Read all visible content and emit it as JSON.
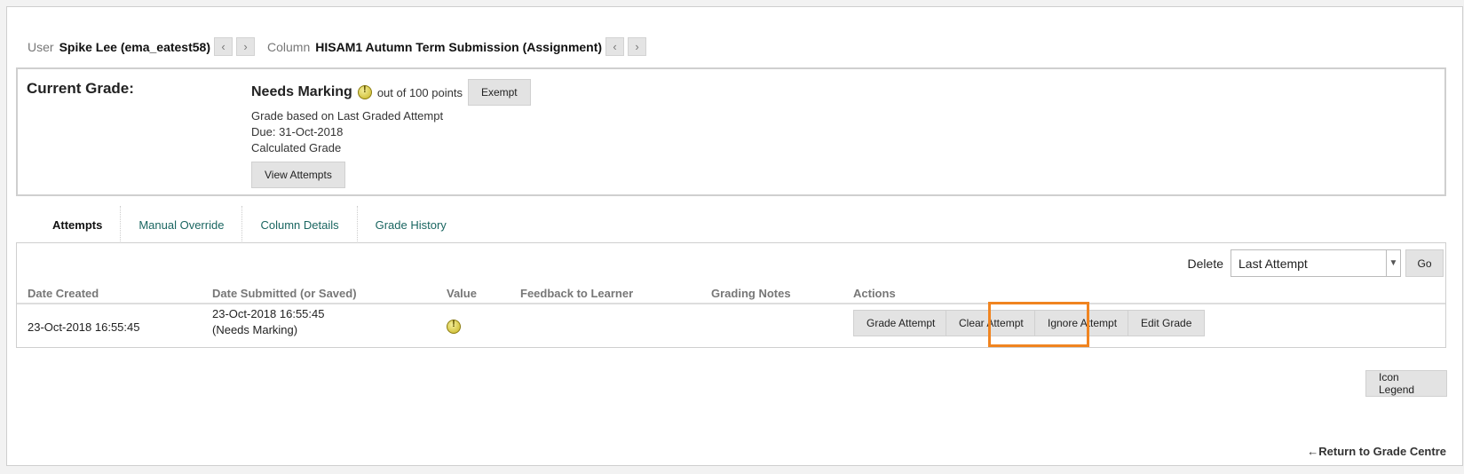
{
  "user_bar": {
    "user_label": "User",
    "user_name": "Spike Lee (ema_eatest58)",
    "column_label": "Column",
    "column_name": "HISAM1 Autumn Term Submission (Assignment)",
    "prev_glyph": "‹",
    "next_glyph": "›"
  },
  "current_grade": {
    "title": "Current Grade:",
    "status": "Needs Marking",
    "out_of": "out of 100 points",
    "exempt_label": "Exempt",
    "basis": "Grade based on Last Graded Attempt",
    "due": "Due: 31-Oct-2018",
    "calc": "Calculated Grade",
    "view_attempts_label": "View Attempts"
  },
  "tabs": [
    {
      "label": "Attempts",
      "active": true
    },
    {
      "label": "Manual Override",
      "active": false
    },
    {
      "label": "Column Details",
      "active": false
    },
    {
      "label": "Grade History",
      "active": false
    }
  ],
  "delete": {
    "label": "Delete",
    "selected": "Last Attempt",
    "go_label": "Go"
  },
  "table": {
    "headers": {
      "date_created": "Date Created",
      "date_submitted": "Date Submitted (or Saved)",
      "value": "Value",
      "feedback": "Feedback to Learner",
      "notes": "Grading Notes",
      "actions": "Actions"
    },
    "rows": [
      {
        "date_created": "23-Oct-2018 16:55:45",
        "date_submitted": "23-Oct-2018 16:55:45",
        "submitted_note": "(Needs Marking)",
        "actions": {
          "grade": "Grade Attempt",
          "clear": "Clear Attempt",
          "ignore": "Ignore Attempt",
          "edit": "Edit Grade"
        }
      }
    ]
  },
  "icon_legend_label": "Icon Legend",
  "return_link": "←Return to Grade Centre",
  "colors": {
    "highlight": "#f08420",
    "tab_link": "#1a6661",
    "needs_marking_icon": "#c8b421"
  },
  "icons": {
    "status": "needs-marking-icon"
  }
}
